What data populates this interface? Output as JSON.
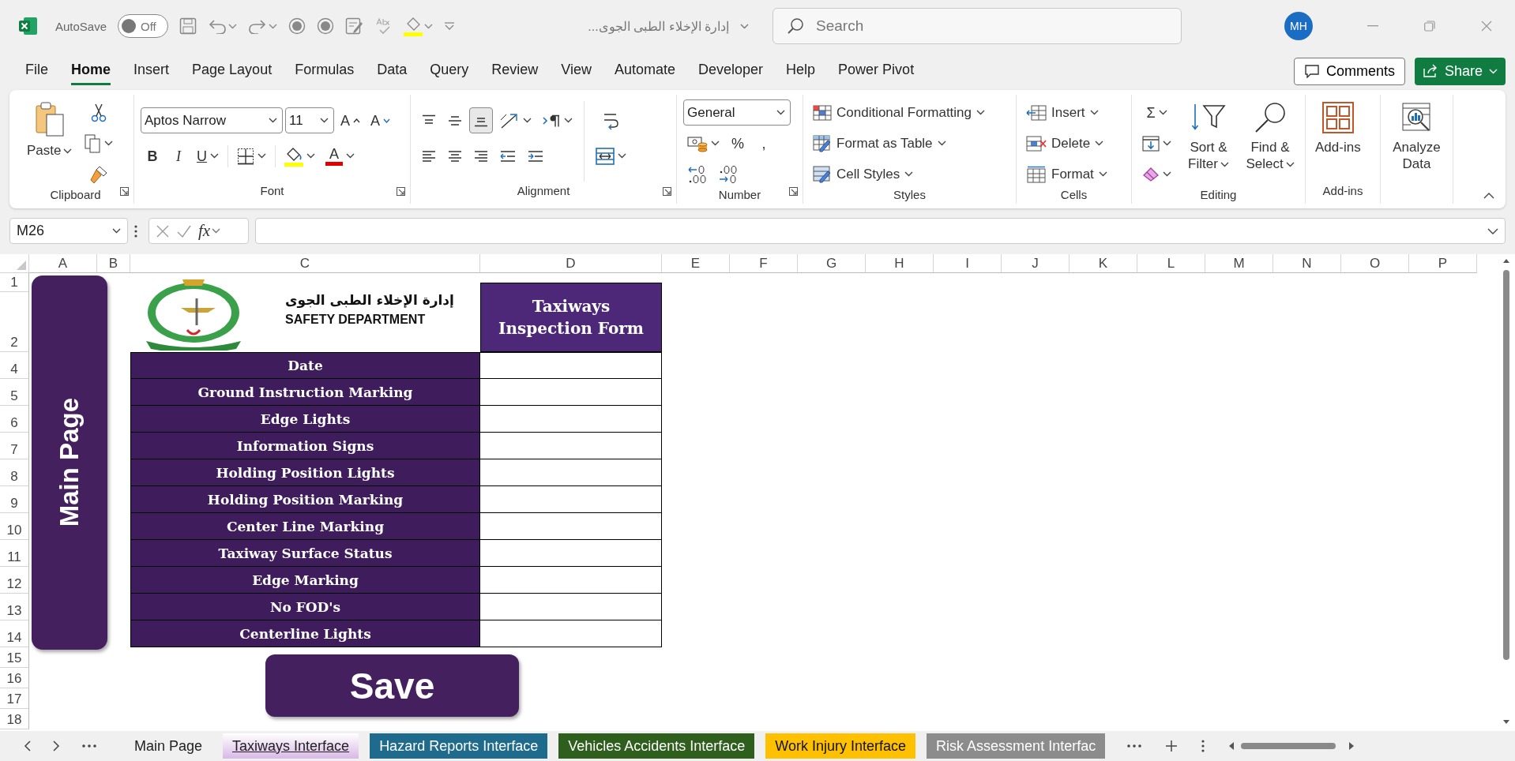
{
  "title_bar": {
    "autosave": {
      "label": "AutoSave",
      "on": false,
      "state_text": "Off"
    },
    "document_title": "إدارة الإخلاء الطبى الجوى...",
    "search": {
      "placeholder": "Search"
    },
    "user_initials": "MH"
  },
  "menu_tabs": [
    {
      "label": "File",
      "selected": false
    },
    {
      "label": "Home",
      "selected": true
    },
    {
      "label": "Insert",
      "selected": false
    },
    {
      "label": "Page Layout",
      "selected": false
    },
    {
      "label": "Formulas",
      "selected": false
    },
    {
      "label": "Data",
      "selected": false
    },
    {
      "label": "Query",
      "selected": false
    },
    {
      "label": "Review",
      "selected": false
    },
    {
      "label": "View",
      "selected": false
    },
    {
      "label": "Automate",
      "selected": false
    },
    {
      "label": "Developer",
      "selected": false
    },
    {
      "label": "Help",
      "selected": false
    },
    {
      "label": "Power Pivot",
      "selected": false
    }
  ],
  "comments_button": "Comments",
  "share_button": "Share",
  "ribbon": {
    "groups": [
      {
        "label": "Clipboard",
        "launcher": true,
        "items": [
          {
            "kind": "large",
            "label": "Paste",
            "caret": true
          },
          {
            "kind": "stack",
            "items": [
              {
                "kind": "tool"
              },
              {
                "kind": "tool",
                "caret": true
              },
              {
                "kind": "tool"
              }
            ]
          }
        ]
      },
      {
        "label": "Font",
        "launcher": true,
        "items": [
          {
            "kind": "stack",
            "items": [
              {
                "kind": "row",
                "items": [
                  {
                    "kind": "wide_select",
                    "value": "Aptos Narrow"
                  },
                  {
                    "kind": "narrow_select",
                    "value": "11"
                  },
                  {
                    "kind": "tool",
                    "label": "A"
                  },
                  {
                    "kind": "tool",
                    "label": "A"
                  }
                ]
              },
              {
                "kind": "row",
                "items": [
                  {
                    "kind": "bold",
                    "label": "B"
                  },
                  {
                    "kind": "italic",
                    "label": "I"
                  },
                  {
                    "kind": "underline",
                    "label": "U",
                    "caret": true
                  },
                  {
                    "kind": "divider"
                  },
                  {
                    "kind": "tool",
                    "caret": true
                  },
                  {
                    "kind": "divider"
                  },
                  {
                    "kind": "tool",
                    "caret": true
                  },
                  {
                    "kind": "tool",
                    "label": "A",
                    "caret": true
                  }
                ]
              }
            ]
          }
        ]
      },
      {
        "label": "Alignment",
        "launcher": true,
        "items": [
          {
            "kind": "stack",
            "items": [
              {
                "kind": "row",
                "items": [
                  {
                    "kind": "tool",
                    "selected": false
                  },
                  {
                    "kind": "tool",
                    "selected": false
                  },
                  {
                    "kind": "tool",
                    "selected": true
                  },
                  {
                    "kind": "tool",
                    "caret": true
                  },
                  {
                    "kind": "tool",
                    "caret": true
                  }
                ]
              },
              {
                "kind": "row",
                "items": [
                  {
                    "kind": "tool",
                    "selected": false
                  },
                  {
                    "kind": "tool",
                    "selected": false
                  },
                  {
                    "kind": "tool",
                    "selected": false
                  },
                  {
                    "kind": "tool"
                  },
                  {
                    "kind": "tool"
                  }
                ]
              }
            ]
          },
          {
            "kind": "divider"
          },
          {
            "kind": "stack",
            "items": [
              {
                "kind": "tool"
              },
              {
                "kind": "tool",
                "caret": true
              }
            ]
          }
        ]
      },
      {
        "label": "Number",
        "launcher": true,
        "items": [
          {
            "kind": "stack",
            "items": [
              {
                "kind": "format_select",
                "value": "General"
              },
              {
                "kind": "row",
                "items": [
                  {
                    "kind": "tool",
                    "caret": true
                  },
                  {
                    "kind": "tool",
                    "label": "%"
                  },
                  {
                    "kind": "tool",
                    "label": ","
                  }
                ]
              },
              {
                "kind": "row",
                "items": [
                  {
                    "kind": "tool"
                  },
                  {
                    "kind": "tool"
                  }
                ]
              }
            ]
          }
        ]
      },
      {
        "label": "Styles",
        "items": [
          {
            "kind": "stack",
            "items": [
              {
                "kind": "text_tool",
                "label": "Conditional Formatting",
                "caret": true
              },
              {
                "kind": "text_tool",
                "label": "Format as Table",
                "caret": true
              },
              {
                "kind": "text_tool",
                "label": "Cell Styles",
                "caret": true
              }
            ]
          }
        ]
      },
      {
        "label": "Cells",
        "items": [
          {
            "kind": "stack",
            "items": [
              {
                "kind": "text_tool",
                "label": "Insert",
                "caret": true
              },
              {
                "kind": "text_tool",
                "label": "Delete",
                "caret": true
              },
              {
                "kind": "text_tool",
                "label": "Format",
                "caret": true
              }
            ]
          }
        ]
      },
      {
        "label": "Editing",
        "items": [
          {
            "kind": "stack",
            "items": [
              {
                "kind": "tool",
                "label": "Σ",
                "caret": true
              },
              {
                "kind": "tool",
                "caret": true
              },
              {
                "kind": "tool",
                "caret": true
              }
            ]
          },
          {
            "kind": "large",
            "label": "Sort & Filter",
            "caret": true
          },
          {
            "kind": "large",
            "label": "Find & Select",
            "caret": true
          }
        ]
      },
      {
        "label": "Add-ins",
        "items": [
          {
            "kind": "large",
            "label": "Add-ins"
          }
        ]
      },
      {
        "items": [
          {
            "kind": "large",
            "label": "Analyze Data"
          }
        ]
      }
    ]
  },
  "formula_bar": {
    "name_box": "M26",
    "function_label": "fx"
  },
  "sheet": {
    "columns": [
      "A",
      "B",
      "C",
      "D",
      "E",
      "F",
      "G",
      "H",
      "I",
      "J",
      "K",
      "L",
      "M",
      "N",
      "O",
      "P"
    ],
    "rows": [
      "1",
      "2",
      "4",
      "5",
      "6",
      "7",
      "8",
      "9",
      "10",
      "11",
      "12",
      "13",
      "14",
      "15",
      "16",
      "17",
      "18"
    ],
    "header": {
      "arabic": "إدارة الإخلاء الطبى الجوى",
      "english": "SAFETY DEPARTMENT"
    },
    "form_title": "Taxiways Inspection Form",
    "form_rows": [
      {
        "label": "Date"
      },
      {
        "label": "Ground Instruction Marking"
      },
      {
        "label": "Edge Lights"
      },
      {
        "label": "Information Signs"
      },
      {
        "label": "Holding Position Lights"
      },
      {
        "label": "Holding Position Marking"
      },
      {
        "label": "Center Line Marking"
      },
      {
        "label": "Taxiway Surface Status"
      },
      {
        "label": "Edge Marking"
      },
      {
        "label": "No FOD's"
      },
      {
        "label": "Centerline Lights"
      }
    ],
    "main_page_button": "Main Page",
    "save_button": "Save"
  },
  "sheet_tabs": [
    {
      "label": "Main Page",
      "selected": false
    },
    {
      "label": "Taxiways Interface",
      "selected": true,
      "color": "#d9b8e6"
    },
    {
      "label": "Hazard Reports Interface",
      "selected": false,
      "color": "#1f6b8e"
    },
    {
      "label": "Vehicles Accidents Interface",
      "selected": false,
      "color": "#2f5f1d"
    },
    {
      "label": "Work Injury Interface",
      "selected": false,
      "color": "#ffc000"
    },
    {
      "label": "Risk Assessment Interfac",
      "selected": false,
      "color": "#8c8c8c"
    }
  ]
}
